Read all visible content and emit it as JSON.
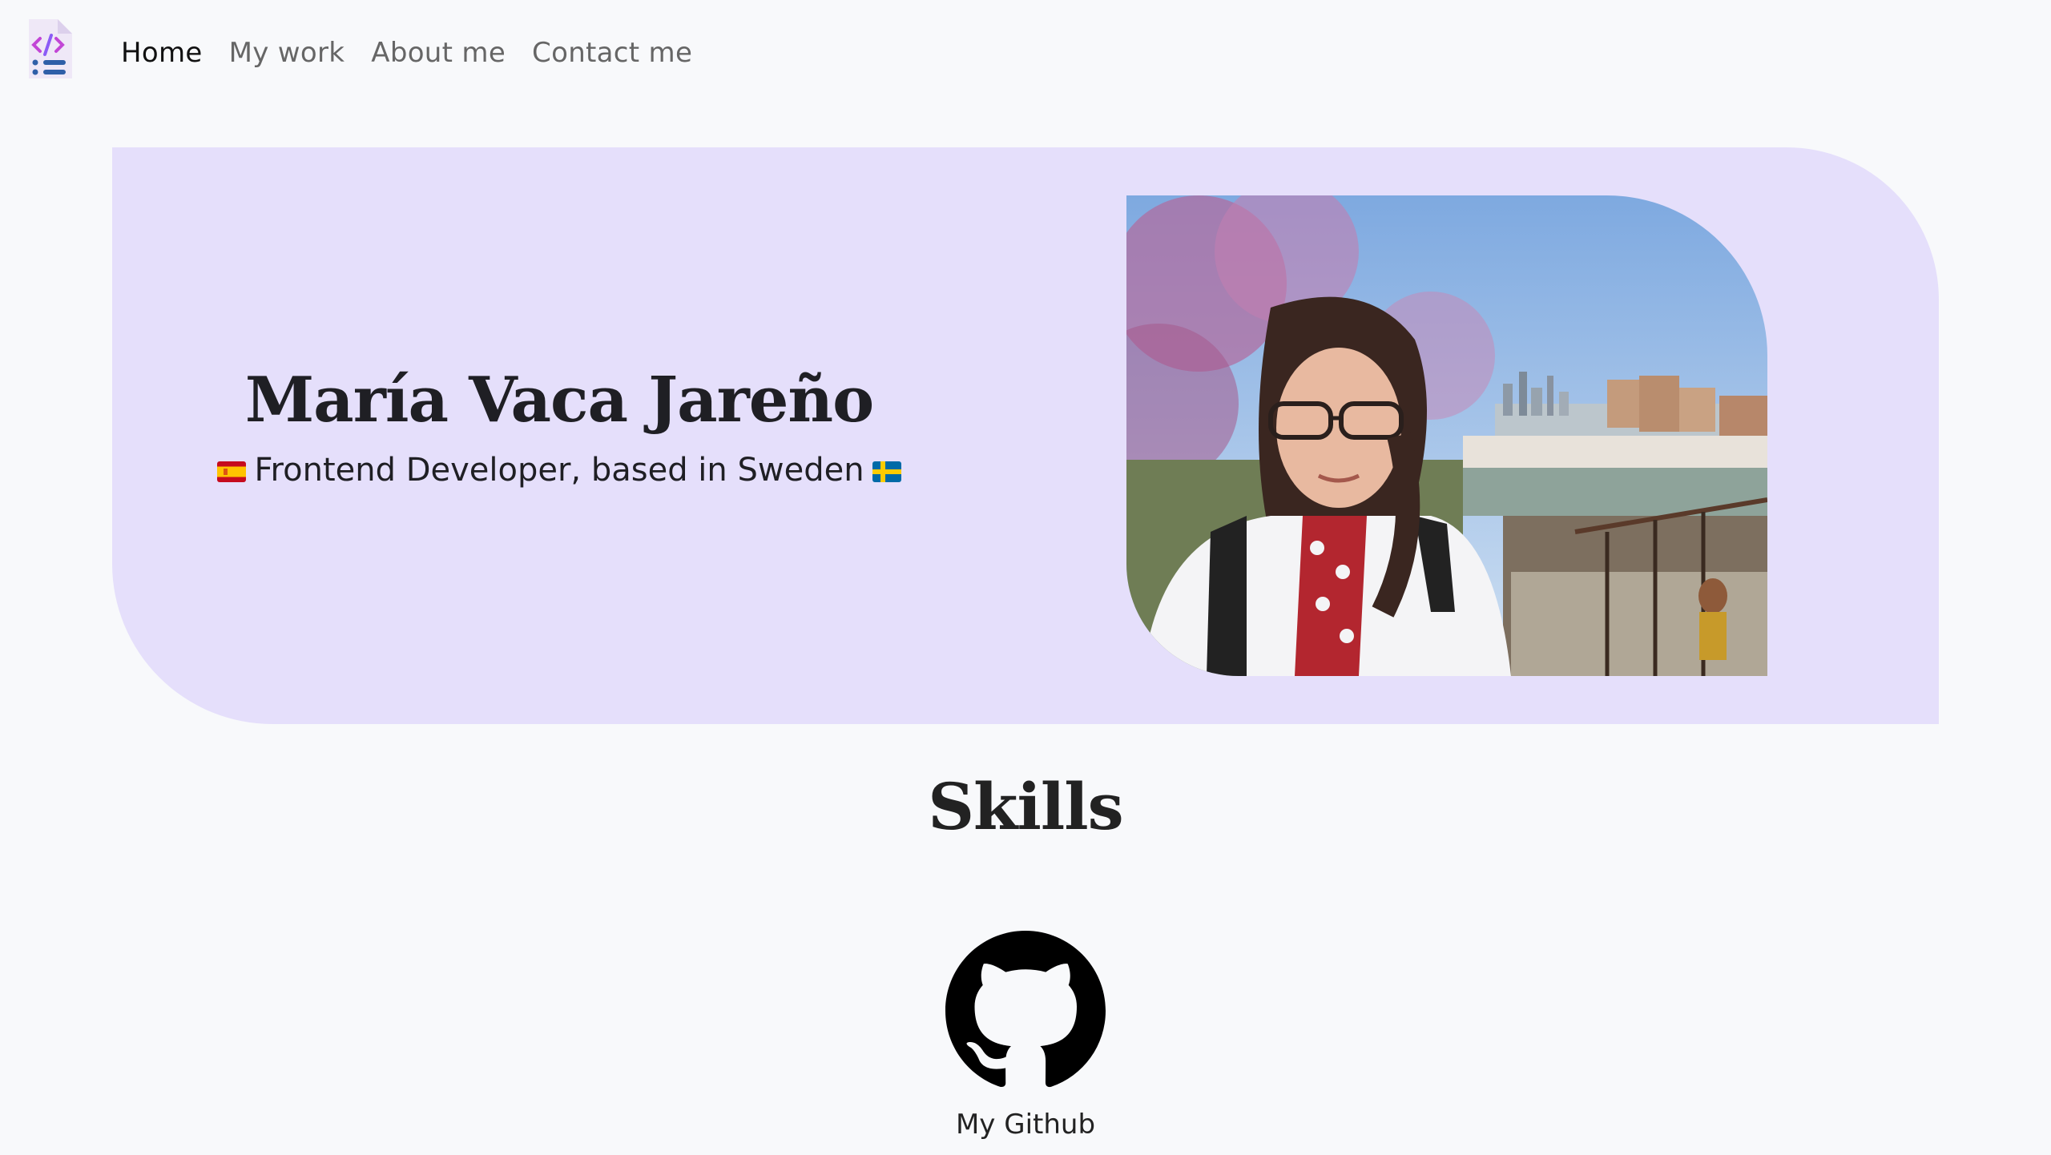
{
  "nav": {
    "items": [
      {
        "label": "Home",
        "active": true
      },
      {
        "label": "My work",
        "active": false
      },
      {
        "label": "About me",
        "active": false
      },
      {
        "label": "Contact me",
        "active": false
      }
    ]
  },
  "hero": {
    "name": "María Vaca Jareño",
    "subtitle": "Frontend Developer, based in Sweden",
    "flags": [
      "spain-flag-icon",
      "sweden-flag-icon"
    ],
    "accent_bg": "#e5dffb"
  },
  "skills": {
    "title": "Skills",
    "github_label": "My Github"
  },
  "icons": {
    "logo": "code-file-icon",
    "github": "github-icon"
  }
}
